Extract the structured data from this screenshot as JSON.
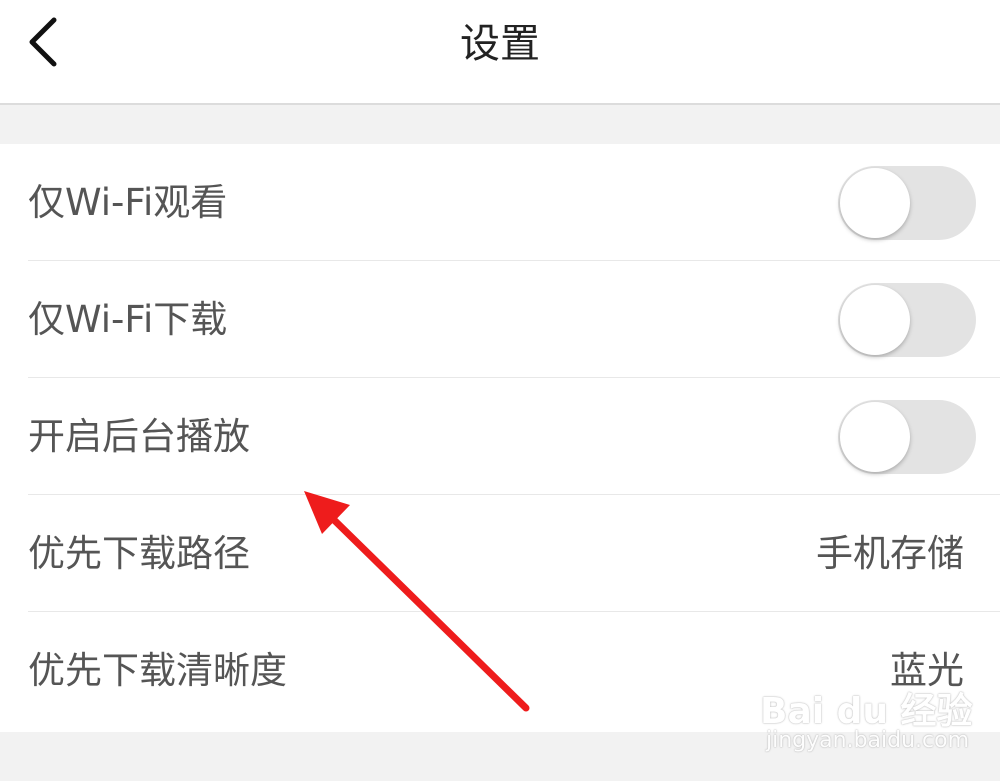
{
  "header": {
    "title": "设置",
    "back_icon": "chevron-left-icon"
  },
  "settings": {
    "wifi_watch": {
      "label": "仅Wi-Fi观看",
      "enabled": false
    },
    "wifi_download": {
      "label": "仅Wi-Fi下载",
      "enabled": false
    },
    "background_play": {
      "label": "开启后台播放",
      "enabled": false
    },
    "download_path": {
      "label": "优先下载路径",
      "value": "手机存储"
    },
    "download_quality": {
      "label": "优先下载清晰度",
      "value": "蓝光"
    }
  },
  "annotation": {
    "arrow_color": "#ee1c1c"
  },
  "watermark": {
    "brand": "Bai du 经验",
    "site": "jingyan.baidu.com"
  },
  "colors": {
    "background": "#f2f2f2",
    "toggle_off": "#e3e3e3",
    "text": "#555555"
  }
}
